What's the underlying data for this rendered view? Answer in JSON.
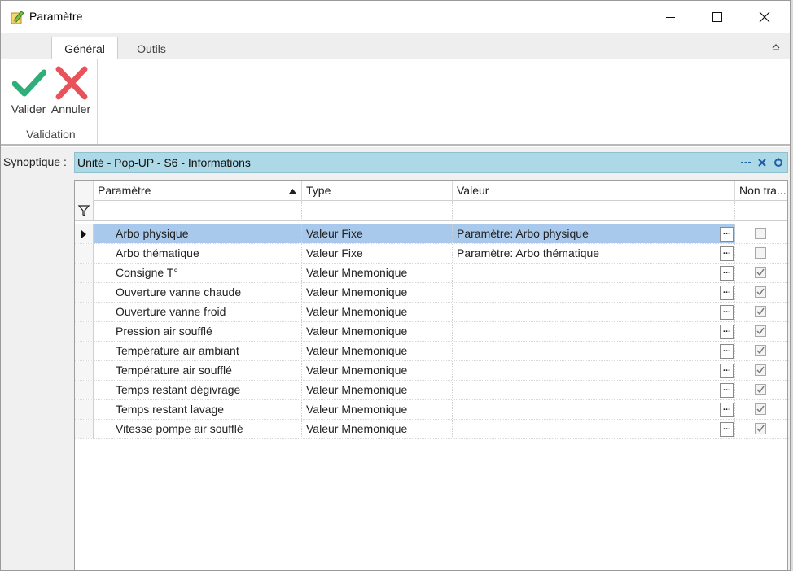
{
  "window": {
    "title": "Paramètre",
    "icon": "pencil-notebook-icon"
  },
  "ribbon": {
    "tabs": [
      {
        "label": "Général",
        "active": true
      },
      {
        "label": "Outils",
        "active": false
      }
    ],
    "group_label": "Validation",
    "valider_label": "Valider",
    "annuler_label": "Annuler",
    "valider_color": "#2fae7a",
    "annuler_color": "#e8535b"
  },
  "synoptique": {
    "label": "Synoptique :",
    "title": "Unité - Pop-UP - S6 - Informations",
    "header_color": "#add8e6"
  },
  "grid": {
    "columns": [
      "Paramètre",
      "Type",
      "Valeur",
      "Non tra..."
    ],
    "sort_column": "Paramètre",
    "sort_direction": "ascending",
    "selection_color": "#a9c9ec",
    "rows": [
      {
        "param": "Arbo physique",
        "type": "Valeur Fixe",
        "value": "Paramètre: Arbo physique",
        "non_tra": false,
        "selected": true
      },
      {
        "param": "Arbo thématique",
        "type": "Valeur Fixe",
        "value": "Paramètre: Arbo thématique",
        "non_tra": false,
        "selected": false
      },
      {
        "param": "Consigne T°",
        "type": "Valeur Mnemonique",
        "value": "",
        "non_tra": true,
        "selected": false
      },
      {
        "param": "Ouverture vanne chaude",
        "type": "Valeur Mnemonique",
        "value": "",
        "non_tra": true,
        "selected": false
      },
      {
        "param": "Ouverture vanne froid",
        "type": "Valeur Mnemonique",
        "value": "",
        "non_tra": true,
        "selected": false
      },
      {
        "param": "Pression air soufflé",
        "type": "Valeur Mnemonique",
        "value": "",
        "non_tra": true,
        "selected": false
      },
      {
        "param": "Température air ambiant",
        "type": "Valeur Mnemonique",
        "value": "",
        "non_tra": true,
        "selected": false
      },
      {
        "param": "Température air soufflé",
        "type": "Valeur Mnemonique",
        "value": "",
        "non_tra": true,
        "selected": false
      },
      {
        "param": "Temps restant dégivrage",
        "type": "Valeur Mnemonique",
        "value": "",
        "non_tra": true,
        "selected": false
      },
      {
        "param": "Temps restant lavage",
        "type": "Valeur Mnemonique",
        "value": "",
        "non_tra": true,
        "selected": false
      },
      {
        "param": "Vitesse pompe air soufflé",
        "type": "Valeur Mnemonique",
        "value": "",
        "non_tra": true,
        "selected": false
      }
    ],
    "ellipsis_label": "..."
  }
}
